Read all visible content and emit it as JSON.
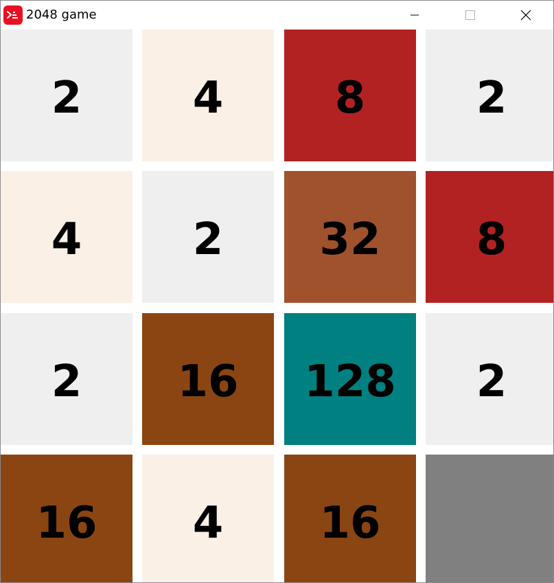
{
  "window": {
    "title": "2048 game"
  },
  "board": {
    "tiles": [
      [
        {
          "value": "2",
          "color": "#efefef"
        },
        {
          "value": "4",
          "color": "#faf0e6"
        },
        {
          "value": "8",
          "color": "#b22222"
        },
        {
          "value": "2",
          "color": "#efefef"
        }
      ],
      [
        {
          "value": "4",
          "color": "#faf0e6"
        },
        {
          "value": "2",
          "color": "#efefef"
        },
        {
          "value": "32",
          "color": "#a0522d"
        },
        {
          "value": "8",
          "color": "#b22222"
        }
      ],
      [
        {
          "value": "2",
          "color": "#efefef"
        },
        {
          "value": "16",
          "color": "#8b4513"
        },
        {
          "value": "128",
          "color": "#008080"
        },
        {
          "value": "2",
          "color": "#efefef"
        }
      ],
      [
        {
          "value": "16",
          "color": "#8b4513"
        },
        {
          "value": "4",
          "color": "#faf0e6"
        },
        {
          "value": "16",
          "color": "#8b4513"
        },
        {
          "value": "",
          "color": "#808080"
        }
      ]
    ]
  },
  "icons": {
    "app": "app-icon",
    "minimize": "minimize-icon",
    "maximize": "maximize-icon",
    "close": "close-icon"
  }
}
